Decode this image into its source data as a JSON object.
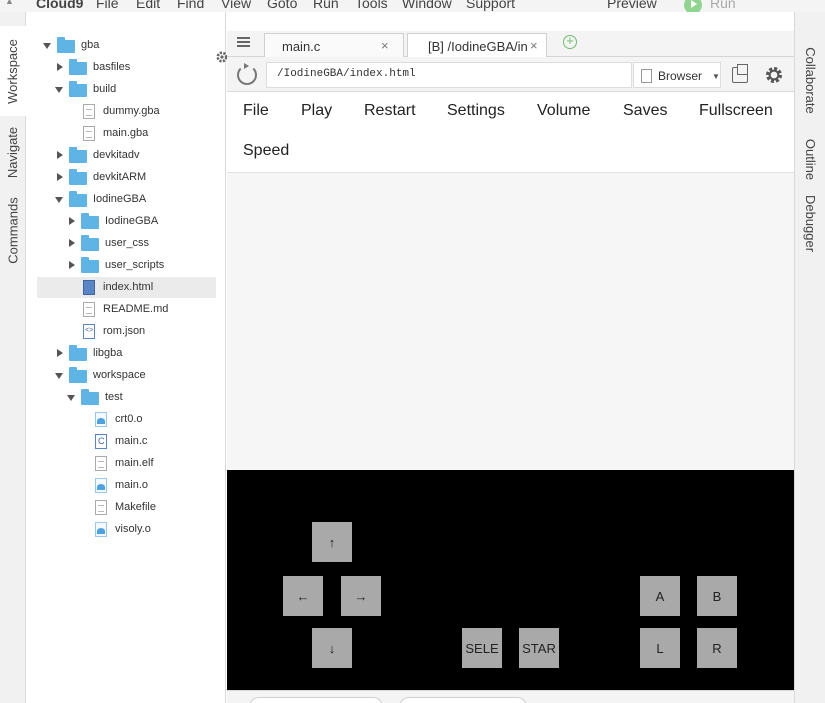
{
  "menubar": {
    "brand": "Cloud9",
    "items": [
      "File",
      "Edit",
      "Find",
      "View",
      "Goto",
      "Run",
      "Tools",
      "Window",
      "Support"
    ],
    "preview": "Preview",
    "run": "Run"
  },
  "left_tabs": [
    "Workspace",
    "Navigate",
    "Commands"
  ],
  "right_tabs": [
    "Collaborate",
    "Outline",
    "Debugger"
  ],
  "tree": [
    {
      "name": "gba",
      "type": "folder",
      "depth": 0,
      "expanded": true
    },
    {
      "name": "basfiles",
      "type": "folder",
      "depth": 1,
      "expanded": false
    },
    {
      "name": "build",
      "type": "folder",
      "depth": 1,
      "expanded": true
    },
    {
      "name": "dummy.gba",
      "type": "file",
      "depth": 2
    },
    {
      "name": "main.gba",
      "type": "file",
      "depth": 2
    },
    {
      "name": "devkitadv",
      "type": "folder",
      "depth": 1,
      "expanded": false
    },
    {
      "name": "devkitARM",
      "type": "folder",
      "depth": 1,
      "expanded": false
    },
    {
      "name": "IodineGBA",
      "type": "folder",
      "depth": 1,
      "expanded": true
    },
    {
      "name": "IodineGBA",
      "type": "folder",
      "depth": 2,
      "expanded": false
    },
    {
      "name": "user_css",
      "type": "folder",
      "depth": 2,
      "expanded": false
    },
    {
      "name": "user_scripts",
      "type": "folder",
      "depth": 2,
      "expanded": false
    },
    {
      "name": "index.html",
      "type": "html",
      "depth": 2,
      "selected": true
    },
    {
      "name": "README.md",
      "type": "file",
      "depth": 2
    },
    {
      "name": "rom.json",
      "type": "json",
      "depth": 2
    },
    {
      "name": "libgba",
      "type": "folder",
      "depth": 1,
      "expanded": false
    },
    {
      "name": "workspace",
      "type": "folder",
      "depth": 1,
      "expanded": true
    },
    {
      "name": "test",
      "type": "folder",
      "depth": 2,
      "expanded": true
    },
    {
      "name": "crt0.o",
      "type": "obj",
      "depth": 3
    },
    {
      "name": "main.c",
      "type": "c",
      "depth": 3
    },
    {
      "name": "main.elf",
      "type": "file",
      "depth": 3
    },
    {
      "name": "main.o",
      "type": "obj",
      "depth": 3
    },
    {
      "name": "Makefile",
      "type": "file",
      "depth": 3
    },
    {
      "name": "visoly.o",
      "type": "obj",
      "depth": 3
    }
  ],
  "tabs": [
    {
      "title": "main.c",
      "close": "×",
      "active": false
    },
    {
      "title": "[B] /IodineGBA/in",
      "close": "×",
      "active": true
    }
  ],
  "add_tab": "+",
  "preview_toolbar": {
    "url": "/IodineGBA/index.html",
    "browser_label": "Browser"
  },
  "gba_menu": [
    "File",
    "Play",
    "Restart",
    "Settings",
    "Volume",
    "Saves",
    "Fullscreen",
    "Speed"
  ],
  "keys": {
    "up": "↑",
    "left": "←",
    "right": "→",
    "down": "↓",
    "select": "SELE",
    "start": "STAR",
    "a": "A",
    "b": "B",
    "l": "L",
    "r": "R"
  }
}
